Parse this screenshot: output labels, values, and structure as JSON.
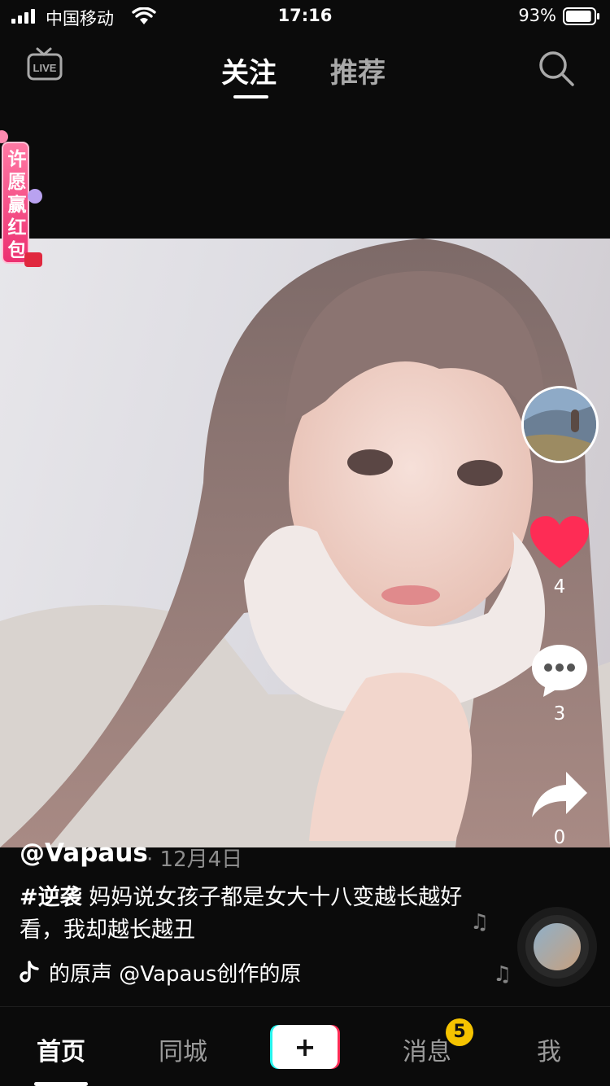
{
  "status_bar": {
    "carrier": "中国移动",
    "time": "17:16",
    "battery": "93%",
    "battery_level": 0.93
  },
  "top_nav": {
    "live_label": "LIVE",
    "tabs": [
      {
        "label": "关注",
        "active": true
      },
      {
        "label": "推荐",
        "active": false
      }
    ]
  },
  "promo": {
    "text": "许愿赢红包"
  },
  "rail": {
    "like_count": "4",
    "comment_count": "3",
    "share_count": "0",
    "like_color": "#fe2c55"
  },
  "post": {
    "author": "@Vapaus",
    "date": "· 12月4日",
    "hashtag": "#逆袭",
    "caption": " 妈妈说女孩子都是女大十八变越长越好看，我却越长越丑",
    "music": "的原声    @Vapaus创作的原"
  },
  "bottom_nav": {
    "home": "首页",
    "nearby": "同城",
    "create": "+",
    "messages": "消息",
    "messages_badge": "5",
    "me": "我"
  },
  "colors": {
    "accent_red": "#fe2c55",
    "accent_cyan": "#25f4ee",
    "badge_yellow": "#f5c300",
    "background": "#0b0b0b"
  }
}
